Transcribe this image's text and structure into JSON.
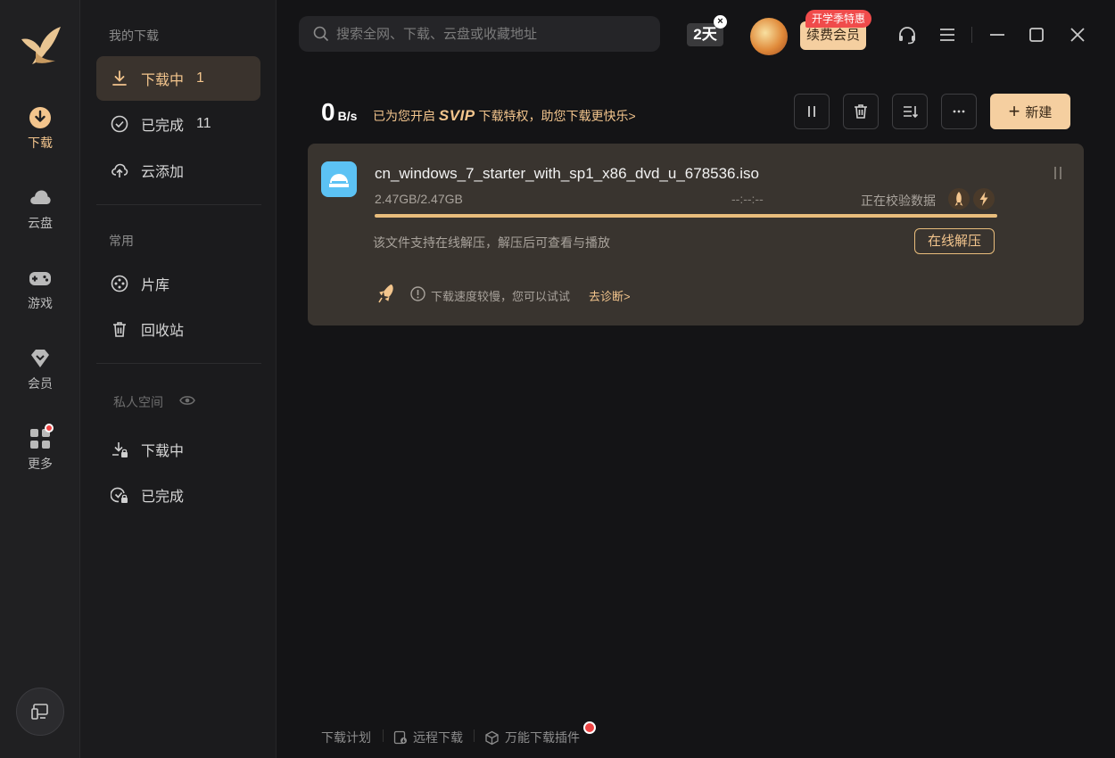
{
  "nav": {
    "section_my_downloads": "我的下载",
    "downloading": {
      "label": "下载中",
      "count": "1"
    },
    "completed": {
      "label": "已完成",
      "count": "11"
    },
    "cloud_add": "云添加",
    "section_common": "常用",
    "library": "片库",
    "recycle": "回收站",
    "section_private": "私人空间",
    "private_downloading": "下载中",
    "private_completed": "已完成"
  },
  "rail": {
    "download": "下载",
    "cloud": "云盘",
    "games": "游戏",
    "vip": "会员",
    "more": "更多"
  },
  "topbar": {
    "search_placeholder": "搜索全网、下载、云盘或收藏地址",
    "days": "2天",
    "renew": "续费会员",
    "promo": "开学季特惠"
  },
  "speed": {
    "value": "0",
    "unit": "B/s",
    "svip_prefix": "已为您开启",
    "svip": "SVIP",
    "svip_suffix": "下载特权，助您下载更快乐>"
  },
  "toolbar": {
    "new": "新建"
  },
  "task": {
    "filename": "cn_windows_7_starter_with_sp1_x86_dvd_u_678536.iso",
    "size": "2.47GB/2.47GB",
    "time": "--:--:--",
    "status": "正在校验数据",
    "progress": 1.0,
    "hint": "该文件支持在线解压，解压后可查看与播放",
    "extract": "在线解压",
    "slow": "下载速度较慢，您可以试试",
    "diagnose": "去诊断>"
  },
  "footer": {
    "plan": "下载计划",
    "remote": "远程下载",
    "plugin": "万能下载插件"
  },
  "colors": {
    "accent": "#f3c58d",
    "accent_bg": "#f5cfa0",
    "card": "#39342f",
    "background": "#141416"
  }
}
